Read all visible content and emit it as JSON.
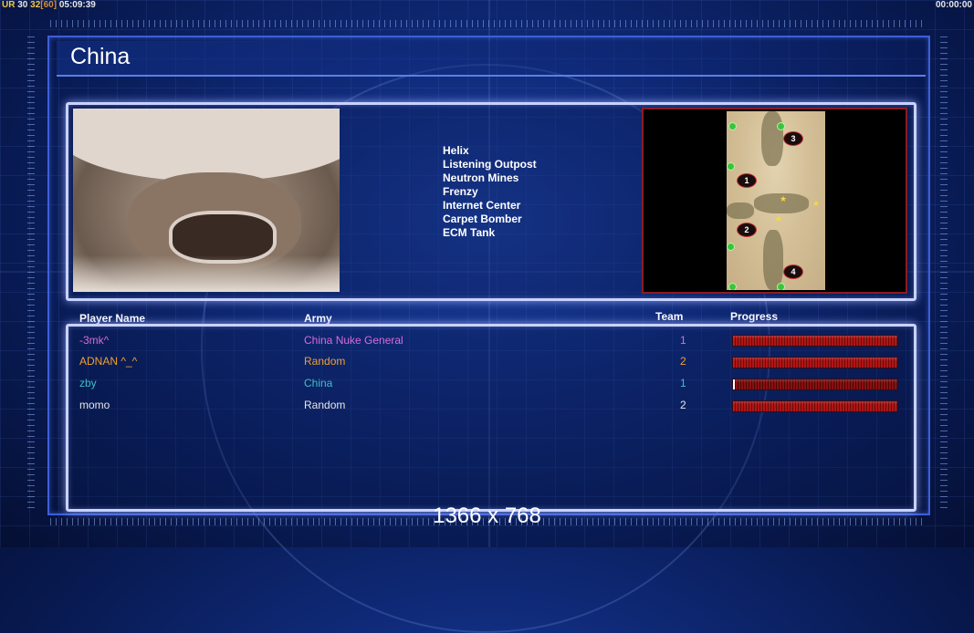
{
  "hud": {
    "left": {
      "a": "UR",
      "b": "30",
      "c": "32",
      "d": "[60]",
      "e": "05:09:39"
    },
    "right": "00:00:00"
  },
  "title": "China",
  "general_powers": [
    "Helix",
    "Listening Outpost",
    "Neutron Mines",
    "Frenzy",
    "Internet Center",
    "Carpet Bomber",
    "ECM Tank"
  ],
  "map": {
    "spawns": [
      "1",
      "2",
      "3",
      "4"
    ]
  },
  "table": {
    "headers": {
      "player": "Player Name",
      "army": "Army",
      "team": "Team",
      "progress": "Progress"
    },
    "rows": [
      {
        "name": "-3mk^",
        "army": "China Nuke General",
        "team": "1",
        "progress": 1.0,
        "color": "#d96bd9"
      },
      {
        "name": "ADNAN ^_^",
        "army": "Random",
        "team": "2",
        "progress": 1.0,
        "color": "#f0a030"
      },
      {
        "name": "zby",
        "army": "China",
        "team": "1",
        "progress": 0.01,
        "color": "#3bc0c8"
      },
      {
        "name": "momo",
        "army": "Random",
        "team": "2",
        "progress": 1.0,
        "color": "#e6e6e6"
      }
    ]
  },
  "resolution": "1366 x 768"
}
